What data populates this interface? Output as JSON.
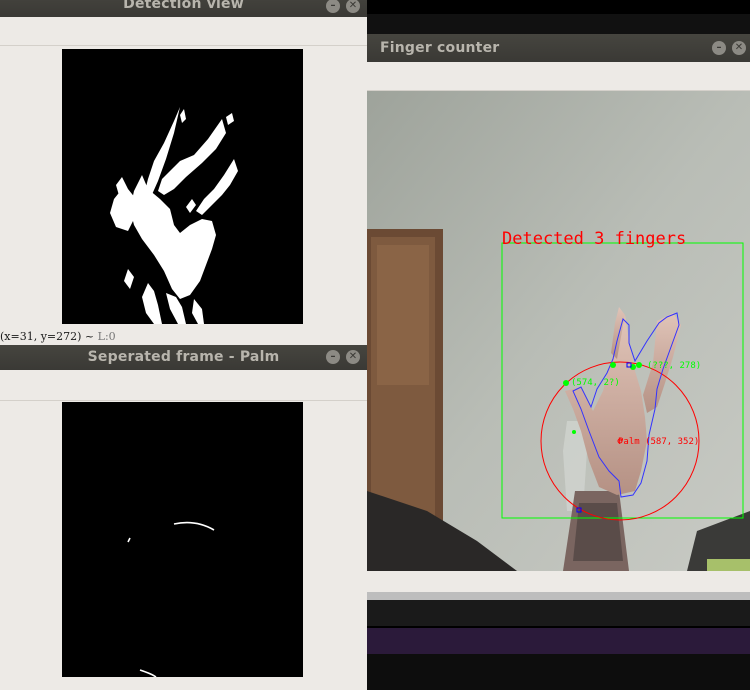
{
  "detection_window": {
    "title": "Detection view",
    "status_text": "(x=31, y=272) ~",
    "status_extra": "L:0"
  },
  "palm_window": {
    "title": "Seperated frame - Palm"
  },
  "finger_window": {
    "title": "Finger counter",
    "overlay_text": "Detected 3 fingers",
    "palm_label": "Palm (587, 352)",
    "finger_labels": [
      "(574, 2?)",
      "(???, 278)"
    ]
  },
  "colors": {
    "titlebar": "#3c3b37",
    "window_bg": "#edeae6",
    "overlay_red": "#ff0000",
    "overlay_green": "#00ff00",
    "contour_blue": "#3333ff",
    "purple_bar": "#2b1a3a"
  },
  "icons": {
    "minimize": "minimize-icon",
    "close": "close-icon"
  }
}
